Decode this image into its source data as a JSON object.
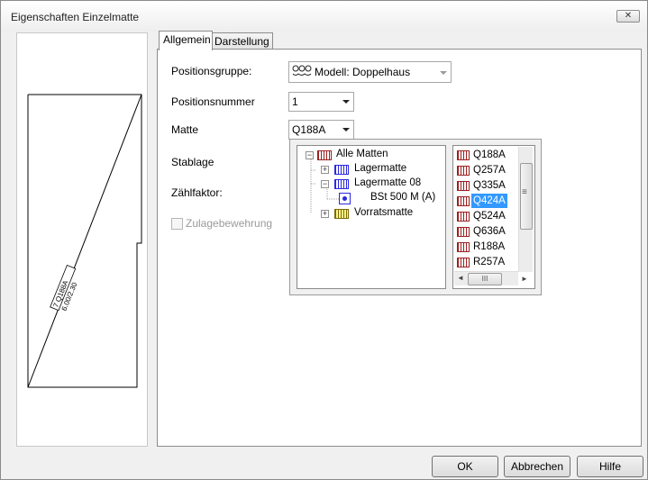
{
  "window": {
    "title": "Eigenschaften Einzelmatte",
    "close_glyph": "✕"
  },
  "tabs": [
    {
      "label": "Allgemein",
      "active": true
    },
    {
      "label": "Darstellung",
      "active": false
    }
  ],
  "preview": {
    "mat_label_line1": "7 Q188A",
    "mat_label_line2": "6.00/2.30"
  },
  "form": {
    "positionsgruppe": {
      "label": "Positionsgruppe:",
      "value": "Modell: Doppelhaus",
      "icon": "group-icon"
    },
    "positionsnummer": {
      "label": "Positionsnummer",
      "value": "1"
    },
    "matte": {
      "label": "Matte",
      "value": "Q188A"
    },
    "stablage": {
      "label": "Stablage"
    },
    "zaehlfaktor": {
      "label": "Zählfaktor:"
    },
    "zulagebewehrung": {
      "label": "Zulagebewehrung",
      "checked": false,
      "enabled": false
    }
  },
  "tree": [
    {
      "label": "Alle Matten",
      "expander": "−",
      "icon": "mat-red-icon"
    },
    {
      "label": "Lagermatte",
      "expander": "+",
      "icon": "mat-blue-icon"
    },
    {
      "label": "Lagermatte 08",
      "expander": "−",
      "icon": "mat-blue-icon"
    },
    {
      "label": "BSt 500 M (A)",
      "expander": "",
      "icon": "steel-grade-icon"
    },
    {
      "label": "Vorratsmatte",
      "expander": "+",
      "icon": "mat-yellow-icon"
    }
  ],
  "mat_list": [
    {
      "label": "Q188A",
      "selected": false
    },
    {
      "label": "Q257A",
      "selected": false
    },
    {
      "label": "Q335A",
      "selected": false
    },
    {
      "label": "Q424A",
      "selected": true
    },
    {
      "label": "Q524A",
      "selected": false
    },
    {
      "label": "Q636A",
      "selected": false
    },
    {
      "label": "R188A",
      "selected": false
    },
    {
      "label": "R257A",
      "selected": false
    }
  ],
  "scrollbar": {
    "left": "◄",
    "right": "►",
    "grip": "III",
    "grip_v": "≡"
  },
  "buttons": {
    "ok": "OK",
    "cancel": "Abbrechen",
    "help": "Hilfe"
  },
  "colors": {
    "selection": "#3399ff",
    "mat_blue": "#2a2ae0",
    "mat_red": "#9c2020"
  }
}
